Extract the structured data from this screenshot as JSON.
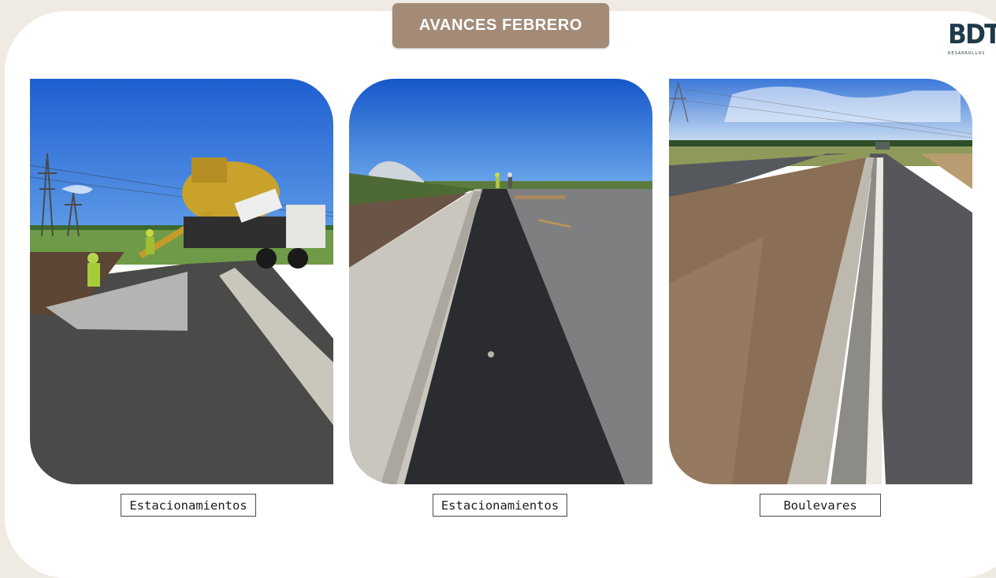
{
  "header": {
    "title": "AVANCES FEBRERO"
  },
  "logo": {
    "mark": "BDT",
    "subtitle": "DESARROLLOS"
  },
  "colors": {
    "background": "#efebe2",
    "sheet": "#ffffff",
    "title_pill": "#a38b77",
    "logo": "#1f3a4a"
  },
  "photos": [
    {
      "caption": "Estacionamientos"
    },
    {
      "caption": "Estacionamientos"
    },
    {
      "caption": "Boulevares"
    }
  ]
}
